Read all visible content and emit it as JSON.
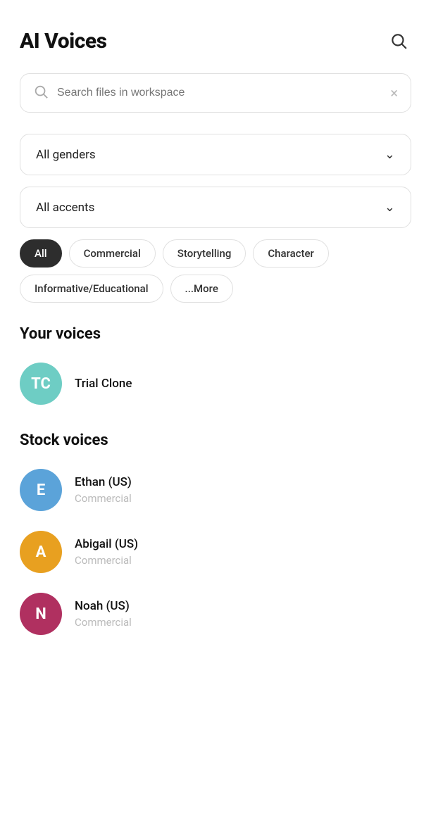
{
  "header": {
    "title": "AI Voices",
    "search_icon_label": "search"
  },
  "search_bar": {
    "placeholder": "Search files in workspace",
    "clear_label": "×"
  },
  "filters": {
    "gender_dropdown": {
      "label": "All genders",
      "chevron": "❯"
    },
    "accent_dropdown": {
      "label": "All accents",
      "chevron": "❯"
    },
    "chips": [
      {
        "label": "All",
        "active": true
      },
      {
        "label": "Commercial",
        "active": false
      },
      {
        "label": "Storytelling",
        "active": false
      },
      {
        "label": "Character",
        "active": false
      },
      {
        "label": "Informative/Educational",
        "active": false
      },
      {
        "label": "...More",
        "active": false
      }
    ]
  },
  "your_voices": {
    "section_title": "Your voices",
    "voices": [
      {
        "initials": "TC",
        "name": "Trial Clone",
        "type": "",
        "avatar_class": "avatar-tc"
      }
    ]
  },
  "stock_voices": {
    "section_title": "Stock voices",
    "voices": [
      {
        "initials": "E",
        "name": "Ethan (US)",
        "type": "Commercial",
        "avatar_class": "avatar-e"
      },
      {
        "initials": "A",
        "name": "Abigail (US)",
        "type": "Commercial",
        "avatar_class": "avatar-a"
      },
      {
        "initials": "N",
        "name": "Noah (US)",
        "type": "Commercial",
        "avatar_class": "avatar-n"
      }
    ]
  }
}
